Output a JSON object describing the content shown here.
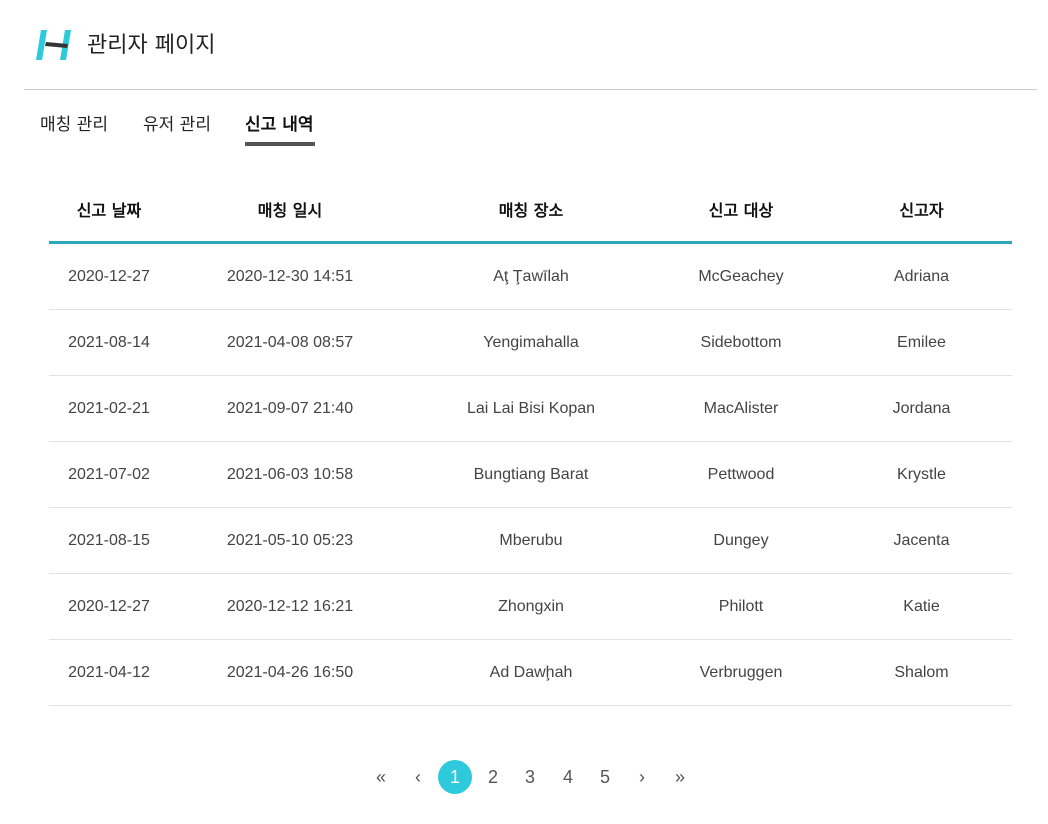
{
  "header": {
    "logo_icon": "dumbbell-logo-icon",
    "title": "관리자 페이지",
    "accent_color": "#2ecadb"
  },
  "tabs": [
    {
      "label": "매칭 관리",
      "active": false
    },
    {
      "label": "유저 관리",
      "active": false
    },
    {
      "label": "신고 내역",
      "active": true
    }
  ],
  "table": {
    "columns": [
      "신고 날짜",
      "매칭 일시",
      "매칭 장소",
      "신고 대상",
      "신고자"
    ],
    "rows": [
      [
        "2020-12-27",
        "2020-12-30 14:51",
        "Aţ Ţawīlah",
        "McGeachey",
        "Adriana"
      ],
      [
        "2021-08-14",
        "2021-04-08 08:57",
        "Yengimahalla",
        "Sidebottom",
        "Emilee"
      ],
      [
        "2021-02-21",
        "2021-09-07 21:40",
        "Lai Lai Bisi Kopan",
        "MacAlister",
        "Jordana"
      ],
      [
        "2021-07-02",
        "2021-06-03 10:58",
        "Bungtiang Barat",
        "Pettwood",
        "Krystle"
      ],
      [
        "2021-08-15",
        "2021-05-10 05:23",
        "Mberubu",
        "Dungey",
        "Jacenta"
      ],
      [
        "2020-12-27",
        "2020-12-12 16:21",
        "Zhongxin",
        "Philott",
        "Katie"
      ],
      [
        "2021-04-12",
        "2021-04-26 16:50",
        "Ad Dawḩah",
        "Verbruggen",
        "Shalom"
      ]
    ]
  },
  "pagination": {
    "first": "«",
    "prev": "‹",
    "pages": [
      "1",
      "2",
      "3",
      "4",
      "5"
    ],
    "current": "1",
    "next": "›",
    "last": "»"
  }
}
